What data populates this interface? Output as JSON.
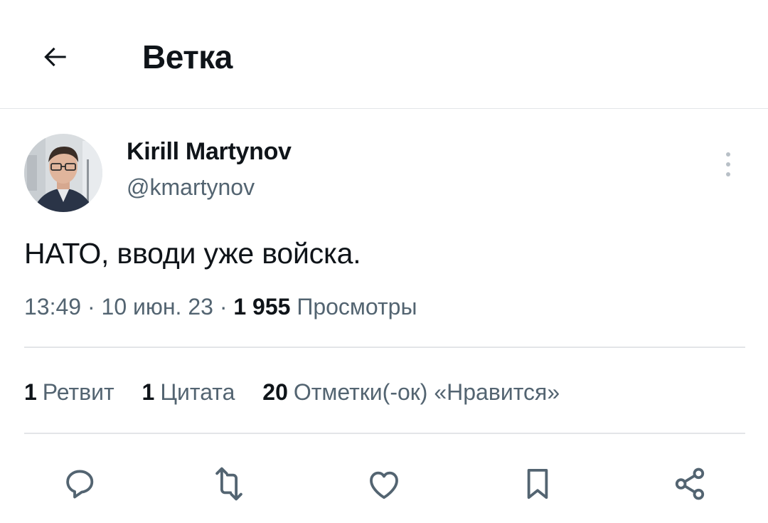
{
  "header": {
    "title": "Ветка",
    "back_icon": "arrow-left-icon"
  },
  "tweet": {
    "author": {
      "name": "Kirill Martynov",
      "handle": "@kmartynov"
    },
    "text": "НАТО, вводи уже войска.",
    "time": "13:49",
    "date": "10 июн. 23",
    "views_count": "1 955",
    "views_label": "Просмотры",
    "separator": " · "
  },
  "stats": {
    "retweets_count": "1",
    "retweets_label": "Ретвит",
    "quotes_count": "1",
    "quotes_label": "Цитата",
    "likes_count": "20",
    "likes_label": "Отметки(-ок) «Нравится»"
  },
  "actions": {
    "icons": [
      "reply-icon",
      "retweet-icon",
      "like-icon",
      "bookmark-icon",
      "share-icon"
    ]
  },
  "colors": {
    "text": "#0f1419",
    "secondary": "#536471",
    "divider": "#e3e5e8",
    "icon": "#536471"
  }
}
